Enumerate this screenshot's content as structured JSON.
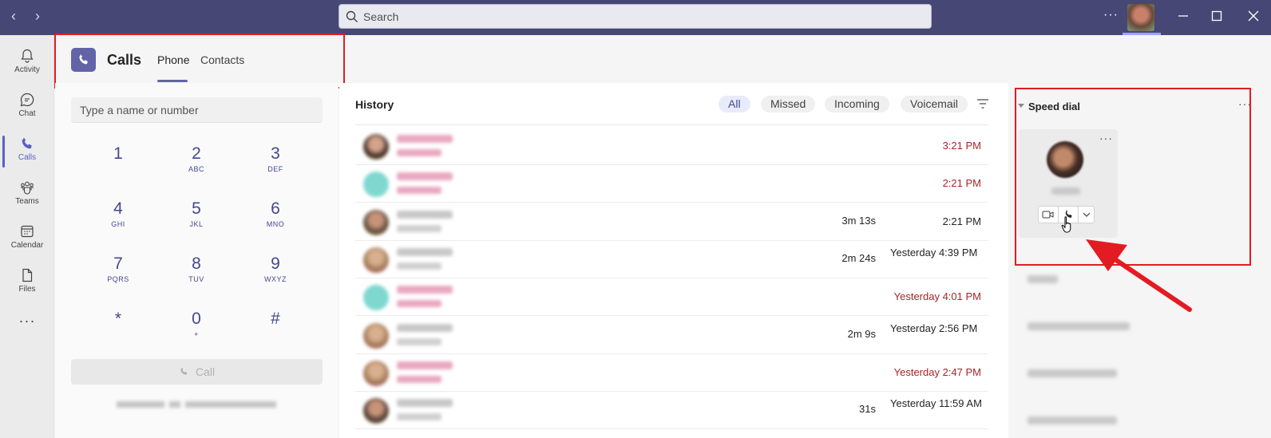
{
  "titlebar": {
    "back_icon": "chevron-left-icon",
    "forward_icon": "chevron-right-icon",
    "search_placeholder": "Search",
    "more_label": "···"
  },
  "rail": {
    "items": [
      {
        "label": "Activity",
        "icon": "bell-icon"
      },
      {
        "label": "Chat",
        "icon": "chat-icon"
      },
      {
        "label": "Calls",
        "icon": "phone-icon",
        "active": true
      },
      {
        "label": "Teams",
        "icon": "teams-icon"
      },
      {
        "label": "Calendar",
        "icon": "calendar-icon"
      },
      {
        "label": "Files",
        "icon": "file-icon"
      }
    ],
    "more_label": "···"
  },
  "header": {
    "title": "Calls",
    "tabs": [
      {
        "label": "Phone",
        "active": true
      },
      {
        "label": "Contacts"
      }
    ]
  },
  "dialer": {
    "input_placeholder": "Type a name or number",
    "keys": [
      {
        "digit": "1",
        "sub": ""
      },
      {
        "digit": "2",
        "sub": "ABC"
      },
      {
        "digit": "3",
        "sub": "DEF"
      },
      {
        "digit": "4",
        "sub": "GHI"
      },
      {
        "digit": "5",
        "sub": "JKL"
      },
      {
        "digit": "6",
        "sub": "MNO"
      },
      {
        "digit": "7",
        "sub": "PQRS"
      },
      {
        "digit": "8",
        "sub": "TUV"
      },
      {
        "digit": "9",
        "sub": "WXYZ"
      },
      {
        "digit": "*",
        "sub": ""
      },
      {
        "digit": "0",
        "sub": "+"
      },
      {
        "digit": "#",
        "sub": ""
      }
    ],
    "call_label": "Call"
  },
  "history": {
    "title": "History",
    "filters": [
      {
        "label": "All",
        "active": true
      },
      {
        "label": "Missed"
      },
      {
        "label": "Incoming"
      },
      {
        "label": "Voicemail"
      }
    ],
    "rows": [
      {
        "duration": "",
        "time": "3:21 PM",
        "missed": true
      },
      {
        "duration": "",
        "time": "2:21 PM",
        "missed": true
      },
      {
        "duration": "3m 13s",
        "time": "2:21 PM",
        "missed": false
      },
      {
        "duration": "2m 24s",
        "time": "Yesterday 4:39 PM",
        "missed": false
      },
      {
        "duration": "",
        "time": "Yesterday 4:01 PM",
        "missed": true
      },
      {
        "duration": "2m 9s",
        "time": "Yesterday 2:56 PM",
        "missed": false
      },
      {
        "duration": "",
        "time": "Yesterday 2:47 PM",
        "missed": true
      },
      {
        "duration": "31s",
        "time": "Yesterday 11:59 AM",
        "missed": false
      }
    ]
  },
  "speed_dial": {
    "title": "Speed dial",
    "more_label": "···",
    "card_more_label": "···"
  },
  "colors": {
    "accent": "#6264a7",
    "titlebar": "#464775",
    "missed": "#a4262c",
    "highlight": "#e31b23"
  }
}
